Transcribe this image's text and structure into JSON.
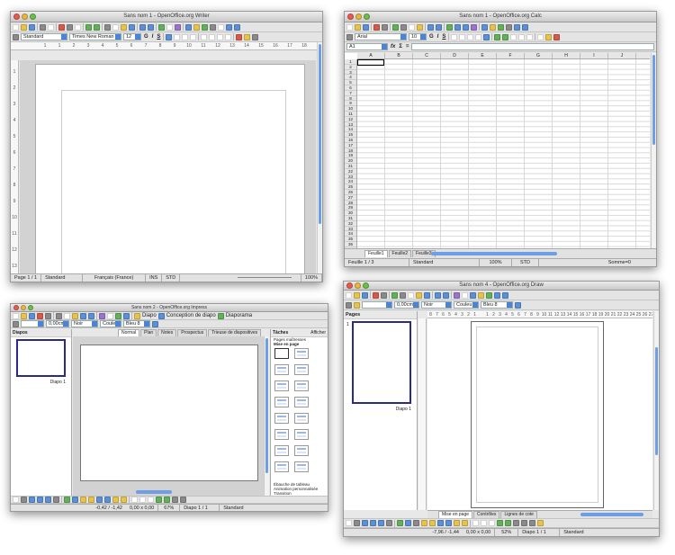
{
  "writer": {
    "title": "Sans nom 1 - OpenOffice.org Writer",
    "style": "Standard",
    "font": "Times New Roman",
    "size": "12",
    "ruler_marks": [
      "1",
      "1",
      "2",
      "3",
      "4",
      "5",
      "6",
      "7",
      "8",
      "9",
      "10",
      "11",
      "12",
      "13",
      "14",
      "15",
      "16",
      "17",
      "18"
    ],
    "vruler_marks": [
      "1",
      "2",
      "3",
      "4",
      "5",
      "6",
      "7",
      "8",
      "9",
      "10",
      "11",
      "12",
      "13"
    ],
    "status": {
      "page": "Page 1 / 1",
      "style": "Standard",
      "lang": "Français (France)",
      "ins": "INS",
      "std": "STD",
      "zoom": "100%"
    }
  },
  "calc": {
    "title": "Sans nom 1 - OpenOffice.org Calc",
    "font": "Arial",
    "size": "10",
    "namebox": "A1",
    "columns": [
      "A",
      "B",
      "C",
      "D",
      "E",
      "F",
      "G",
      "H",
      "I",
      "J"
    ],
    "rows": [
      "1",
      "2",
      "3",
      "4",
      "5",
      "6",
      "7",
      "8",
      "9",
      "10",
      "11",
      "12",
      "13",
      "14",
      "15",
      "16",
      "17",
      "18",
      "19",
      "20",
      "21",
      "22",
      "23",
      "24",
      "25",
      "26",
      "27",
      "28",
      "29",
      "30",
      "31",
      "32",
      "33",
      "34",
      "35",
      "36",
      "37"
    ],
    "sheets": [
      "Feuille1",
      "Feuille2",
      "Feuille3"
    ],
    "status": {
      "sheet": "Feuille 1 / 3",
      "style": "Standard",
      "zoom": "100%",
      "std": "STD",
      "sum": "Somme=0"
    }
  },
  "impress": {
    "title": "Sans nom 2 - OpenOffice.org Impress",
    "slides_label": "Diapos",
    "slide_name": "Diapo 1",
    "line_width": "0,00cm",
    "color_name": "Noir",
    "fill_label": "Couleu",
    "fill_name": "Bleu 8",
    "toolbar_items": [
      "Diapo",
      "Conception de diapo",
      "Diaporama"
    ],
    "view_tabs": [
      "Normal",
      "Plan",
      "Notes",
      "Prospectus",
      "Trieuse de diapositives"
    ],
    "tasks_label": "Tâches",
    "tasks_view": "Afficher",
    "task_sections": [
      "Pages maîtresses",
      "Mise en page"
    ],
    "task_footer": [
      "Ébauche de tableau",
      "Animation personnalisée",
      "Transition"
    ],
    "status": {
      "pos": "-0,42 / -1,42",
      "size": "0,00 x 0,00",
      "zoom": "67%",
      "slide": "Diapo 1 / 1",
      "style": "Standard"
    }
  },
  "draw": {
    "title": "Sans nom 4 - OpenOffice.org Draw",
    "pages_label": "Pages",
    "page_num": "1",
    "page_name": "Diapo 1",
    "line_width": "0,00cm",
    "color_name": "Noir",
    "fill_label": "Couleu",
    "fill_name": "Bleu 8",
    "ruler_marks": [
      "8",
      "7",
      "6",
      "5",
      "4",
      "3",
      "2",
      "1",
      "",
      "1",
      "2",
      "3",
      "4",
      "5",
      "6",
      "7",
      "8",
      "9",
      "10",
      "11",
      "12",
      "13",
      "14",
      "15",
      "16",
      "17",
      "18",
      "19",
      "20",
      "21",
      "22",
      "23",
      "24",
      "25",
      "26",
      "27"
    ],
    "layer_tabs": [
      "Mise en page",
      "Contrôles",
      "Lignes de cote"
    ],
    "status": {
      "pos": "-7,96 / -1,44",
      "size": "0,00 x 0,00",
      "zoom": "52%",
      "page": "Diapo 1 / 1",
      "style": "Standard"
    }
  },
  "colors": {
    "accent": "#4b83d9",
    "slide_border": "#2a2a8a"
  }
}
